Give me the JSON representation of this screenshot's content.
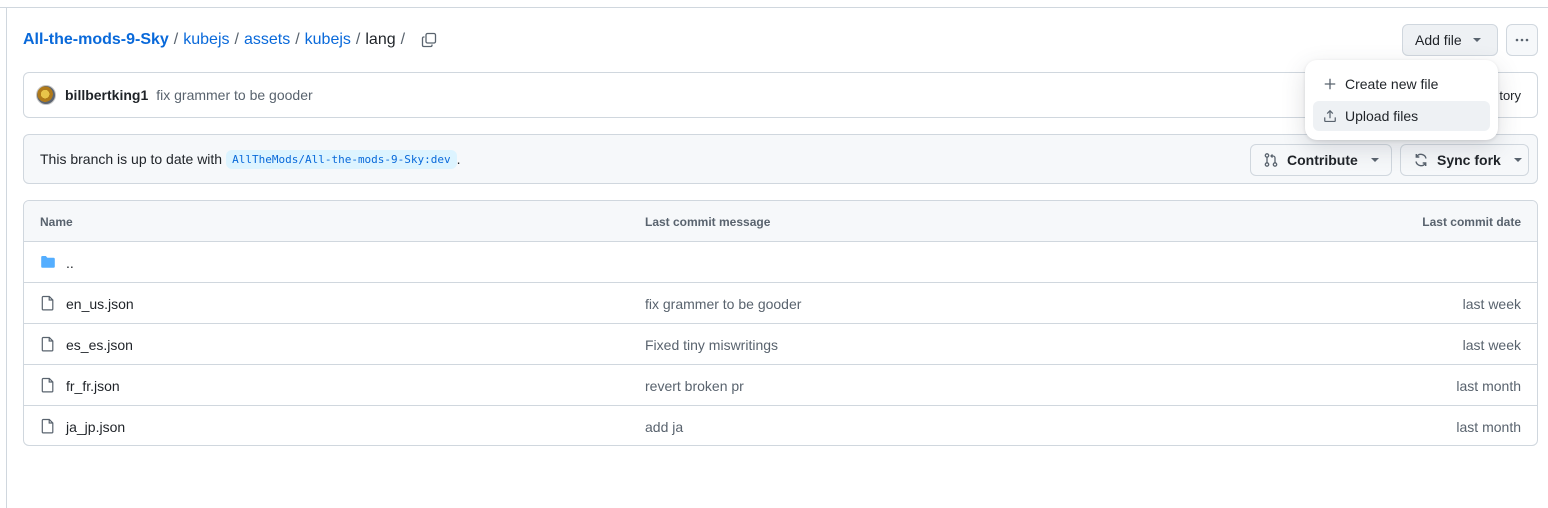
{
  "breadcrumb": {
    "repo": "All-the-mods-9-Sky",
    "path": [
      "kubejs",
      "assets",
      "kubejs"
    ],
    "current": "lang",
    "sep": "/"
  },
  "header": {
    "add_file_label": "Add file"
  },
  "dropdown": {
    "items": [
      {
        "label": "Create new file",
        "icon": "plus-icon"
      },
      {
        "label": "Upload files",
        "icon": "upload-icon"
      }
    ]
  },
  "commit": {
    "author": "billbertking1",
    "message": "fix grammer to be gooder",
    "history_label": "tory"
  },
  "branch": {
    "status_text": "This branch is up to date with",
    "ref": "AllTheMods/All-the-mods-9-Sky:dev",
    "period": ".",
    "contribute_label": "Contribute",
    "sync_label": "Sync fork"
  },
  "table": {
    "headers": {
      "name": "Name",
      "message": "Last commit message",
      "date": "Last commit date"
    },
    "parent": "..",
    "rows": [
      {
        "name": "en_us.json",
        "message": "fix grammer to be gooder",
        "date": "last week"
      },
      {
        "name": "es_es.json",
        "message": "Fixed tiny miswritings",
        "date": "last week"
      },
      {
        "name": "fr_fr.json",
        "message": "revert broken pr",
        "date": "last month"
      },
      {
        "name": "ja_jp.json",
        "message": "add ja",
        "date": "last month"
      }
    ]
  },
  "colors": {
    "link": "#0969da",
    "folder": "#54aeff",
    "border": "#d0d7de",
    "muted": "#59636e"
  }
}
